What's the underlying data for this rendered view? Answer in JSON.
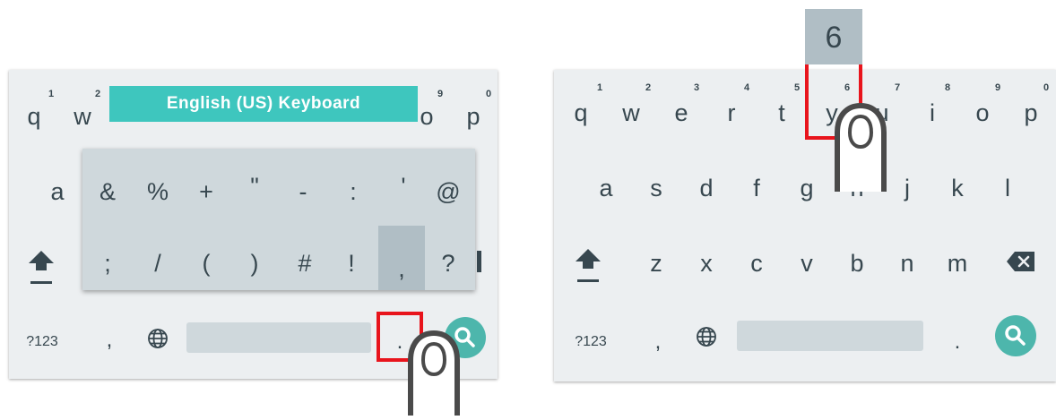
{
  "left_keyboard": {
    "banner": "English (US) Keyboard",
    "top_row_visible": [
      {
        "key": "q",
        "hint": "1"
      },
      {
        "key": "w",
        "hint": "2"
      },
      {
        "key": "o",
        "hint": "9"
      },
      {
        "key": "p",
        "hint": "0"
      }
    ],
    "a_key": "a",
    "popup_row1": [
      "&",
      "%",
      "+",
      "\"",
      "-",
      ":",
      "'",
      "@"
    ],
    "popup_row2": [
      ";",
      "/",
      "(",
      ")",
      "#",
      "!",
      ",",
      "?"
    ],
    "popup_selected": ",",
    "bottom": {
      "symbols_label": "?123",
      "comma": ",",
      "period": "."
    }
  },
  "right_keyboard": {
    "row1": [
      {
        "key": "q",
        "hint": "1"
      },
      {
        "key": "w",
        "hint": "2"
      },
      {
        "key": "e",
        "hint": "3"
      },
      {
        "key": "r",
        "hint": "4"
      },
      {
        "key": "t",
        "hint": "5"
      },
      {
        "key": "y",
        "hint": "6"
      },
      {
        "key": "u",
        "hint": "7"
      },
      {
        "key": "i",
        "hint": "8"
      },
      {
        "key": "o",
        "hint": "9"
      },
      {
        "key": "p",
        "hint": "0"
      }
    ],
    "row2": [
      "a",
      "s",
      "d",
      "f",
      "g",
      "h",
      "j",
      "k",
      "l"
    ],
    "row3": [
      "z",
      "x",
      "c",
      "v",
      "b",
      "n",
      "m"
    ],
    "key_preview": "6",
    "bottom": {
      "symbols_label": "?123",
      "comma": ",",
      "period": "."
    }
  },
  "colors": {
    "keyboard_bg": "#eceff1",
    "banner": "#3ec6be",
    "search_button": "#4db6ac",
    "highlight_box": "#e8141c"
  },
  "icons": [
    "shift-icon",
    "globe-icon",
    "search-icon",
    "backspace-icon",
    "finger-icon"
  ]
}
